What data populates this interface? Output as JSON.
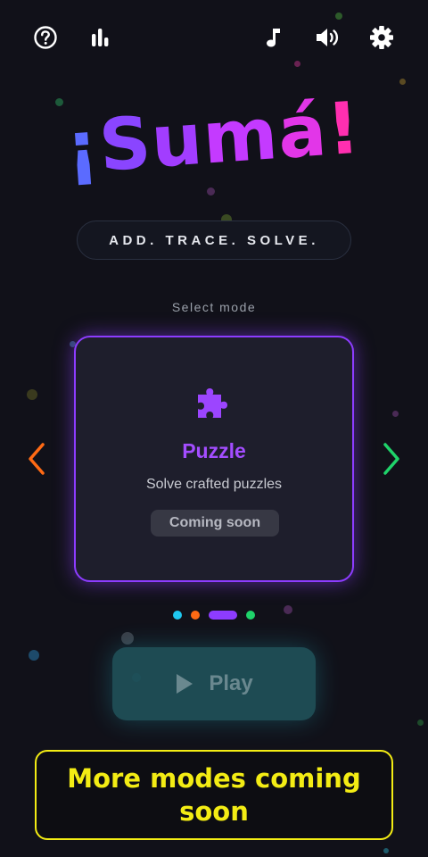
{
  "topbar": {
    "icons": [
      "help-icon",
      "stats-icon",
      "music-icon",
      "volume-icon",
      "settings-icon"
    ]
  },
  "logo": {
    "chars": [
      "¡",
      "S",
      "u",
      "m",
      "á",
      "!"
    ],
    "colors": [
      "#5b6bff",
      "#8a45ff",
      "#a23dff",
      "#c43aff",
      "#e236e8",
      "#ff2fb0"
    ]
  },
  "tagline": "ADD. TRACE. SOLVE.",
  "mode_select": {
    "label": "Select mode",
    "current": {
      "icon": "puzzle-icon",
      "title": "Puzzle",
      "description": "Solve crafted puzzles",
      "badge": "Coming soon",
      "accent": "#8d3cff"
    },
    "prev_arrow_color": "#ff6a14",
    "next_arrow_color": "#1fd36a",
    "pager": {
      "count": 4,
      "active_index": 2,
      "colors": [
        "#1fc8f0",
        "#ff6a14",
        "#8d3cff",
        "#1fd36a"
      ]
    }
  },
  "play": {
    "label": "Play",
    "enabled": false
  },
  "banner": {
    "text": "More modes coming soon",
    "color": "#f3ec14"
  }
}
